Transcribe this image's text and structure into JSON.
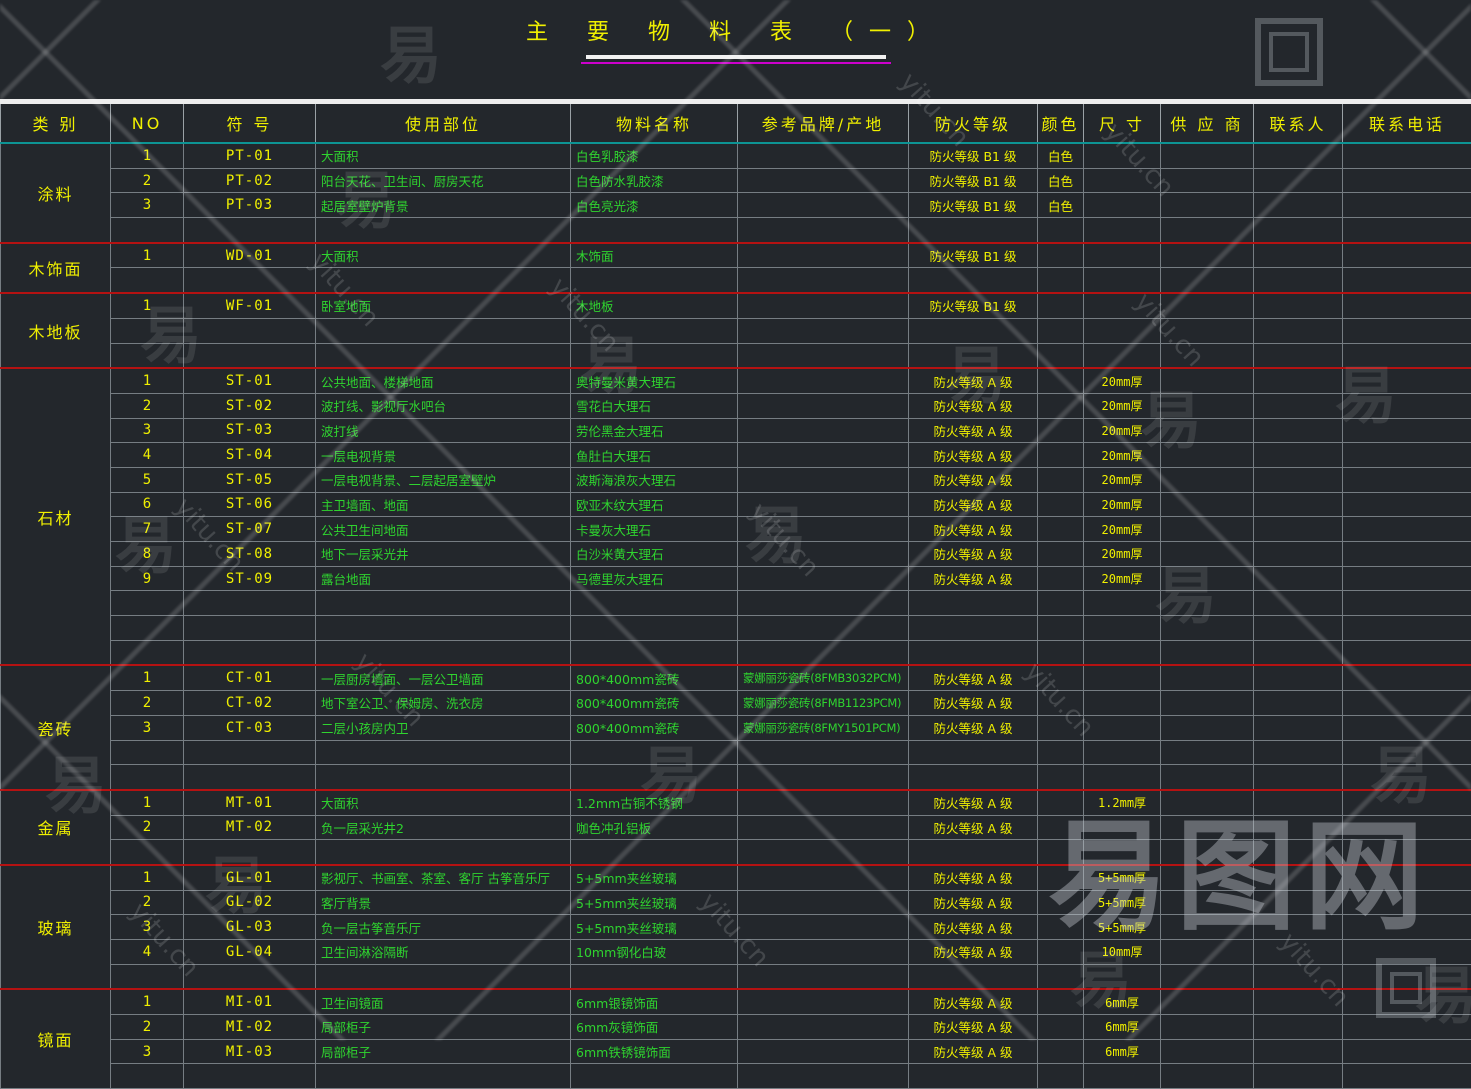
{
  "title": {
    "text": "主 要 物 料 表 （一）"
  },
  "colors": {
    "background": "#23272c",
    "text_yellow": "#f0f000",
    "text_green": "#2fd42f",
    "section_line_red": "#b51212",
    "header_line_teal": "#0d9494",
    "title_underline_white": "#f2f2f2",
    "title_underline_magenta": "#cc00cc"
  },
  "watermark": {
    "site_text": "yitu.cn",
    "brand_text": "易图网",
    "glyph_text": "易"
  },
  "table": {
    "headers": [
      "类 别",
      "NO",
      "符   号",
      "使用部位",
      "物料名称",
      "参考品牌/产地",
      "防火等级",
      "颜色",
      "尺  寸",
      "供  应  商",
      "联系人",
      "联系电话"
    ],
    "column_keys": [
      "no",
      "code",
      "location",
      "material",
      "brand",
      "fire",
      "color",
      "size",
      "supplier",
      "contact",
      "phone"
    ],
    "sections": [
      {
        "category": "涂料",
        "trailing_empty_rows": 1,
        "rows": [
          {
            "no": "1",
            "code": "PT-01",
            "location": "大面积",
            "material": "白色乳胶漆",
            "brand": "",
            "fire": "防火等级 B1 级",
            "color": "白色",
            "size": "",
            "supplier": "",
            "contact": "",
            "phone": ""
          },
          {
            "no": "2",
            "code": "PT-02",
            "location": "阳台天花、卫生间、厨房天花",
            "material": "白色防水乳胶漆",
            "brand": "",
            "fire": "防火等级 B1 级",
            "color": "白色",
            "size": "",
            "supplier": "",
            "contact": "",
            "phone": ""
          },
          {
            "no": "3",
            "code": "PT-03",
            "location": "起居室壁炉背景",
            "material": "白色亮光漆",
            "brand": "",
            "fire": "防火等级 B1 级",
            "color": "白色",
            "size": "",
            "supplier": "",
            "contact": "",
            "phone": ""
          }
        ]
      },
      {
        "category": "木饰面",
        "trailing_empty_rows": 1,
        "rows": [
          {
            "no": "1",
            "code": "WD-01",
            "location": "大面积",
            "material": "木饰面",
            "brand": "",
            "fire": "防火等级 B1 级",
            "color": "",
            "size": "",
            "supplier": "",
            "contact": "",
            "phone": ""
          }
        ]
      },
      {
        "category": "木地板",
        "trailing_empty_rows": 2,
        "rows": [
          {
            "no": "1",
            "code": "WF-01",
            "location": "卧室地面",
            "material": "木地板",
            "brand": "",
            "fire": "防火等级 B1 级",
            "color": "",
            "size": "",
            "supplier": "",
            "contact": "",
            "phone": ""
          }
        ]
      },
      {
        "category": "石材",
        "trailing_empty_rows": 3,
        "rows": [
          {
            "no": "1",
            "code": "ST-01",
            "location": "公共地面、楼梯地面",
            "material": "奥特曼米黄大理石",
            "brand": "",
            "fire": "防火等级 A 级",
            "color": "",
            "size": "20mm厚",
            "supplier": "",
            "contact": "",
            "phone": ""
          },
          {
            "no": "2",
            "code": "ST-02",
            "location": "波打线、影视厅水吧台",
            "material": "雪花白大理石",
            "brand": "",
            "fire": "防火等级 A 级",
            "color": "",
            "size": "20mm厚",
            "supplier": "",
            "contact": "",
            "phone": ""
          },
          {
            "no": "3",
            "code": "ST-03",
            "location": "波打线",
            "material": "劳伦黑金大理石",
            "brand": "",
            "fire": "防火等级 A 级",
            "color": "",
            "size": "20mm厚",
            "supplier": "",
            "contact": "",
            "phone": ""
          },
          {
            "no": "4",
            "code": "ST-04",
            "location": "一层电视背景",
            "material": "鱼肚白大理石",
            "brand": "",
            "fire": "防火等级 A 级",
            "color": "",
            "size": "20mm厚",
            "supplier": "",
            "contact": "",
            "phone": ""
          },
          {
            "no": "5",
            "code": "ST-05",
            "location": "一层电视背景、二层起居室壁炉",
            "material": "波斯海浪灰大理石",
            "brand": "",
            "fire": "防火等级 A 级",
            "color": "",
            "size": "20mm厚",
            "supplier": "",
            "contact": "",
            "phone": ""
          },
          {
            "no": "6",
            "code": "ST-06",
            "location": "主卫墙面、地面",
            "material": "欧亚木纹大理石",
            "brand": "",
            "fire": "防火等级 A 级",
            "color": "",
            "size": "20mm厚",
            "supplier": "",
            "contact": "",
            "phone": ""
          },
          {
            "no": "7",
            "code": "ST-07",
            "location": "公共卫生间地面",
            "material": "卡曼灰大理石",
            "brand": "",
            "fire": "防火等级 A 级",
            "color": "",
            "size": "20mm厚",
            "supplier": "",
            "contact": "",
            "phone": ""
          },
          {
            "no": "8",
            "code": "ST-08",
            "location": "地下一层采光井",
            "material": "白沙米黄大理石",
            "brand": "",
            "fire": "防火等级 A 级",
            "color": "",
            "size": "20mm厚",
            "supplier": "",
            "contact": "",
            "phone": ""
          },
          {
            "no": "9",
            "code": "ST-09",
            "location": "露台地面",
            "material": "马德里灰大理石",
            "brand": "",
            "fire": "防火等级 A 级",
            "color": "",
            "size": "20mm厚",
            "supplier": "",
            "contact": "",
            "phone": ""
          }
        ]
      },
      {
        "category": "瓷砖",
        "trailing_empty_rows": 2,
        "rows": [
          {
            "no": "1",
            "code": "CT-01",
            "location": "一层厨房墙面、一层公卫墙面",
            "material": "800*400mm瓷砖",
            "brand": "蒙娜丽莎瓷砖(8FMB3032PCM)",
            "fire": "防火等级 A 级",
            "color": "",
            "size": "",
            "supplier": "",
            "contact": "",
            "phone": ""
          },
          {
            "no": "2",
            "code": "CT-02",
            "location": "地下室公卫、保姆房、洗衣房",
            "material": "800*400mm瓷砖",
            "brand": "蒙娜丽莎瓷砖(8FMB1123PCM)",
            "fire": "防火等级 A 级",
            "color": "",
            "size": "",
            "supplier": "",
            "contact": "",
            "phone": ""
          },
          {
            "no": "3",
            "code": "CT-03",
            "location": "二层小孩房内卫",
            "material": "800*400mm瓷砖",
            "brand": "蒙娜丽莎瓷砖(8FMY1501PCM)",
            "fire": "防火等级 A 级",
            "color": "",
            "size": "",
            "supplier": "",
            "contact": "",
            "phone": ""
          }
        ]
      },
      {
        "category": "金属",
        "trailing_empty_rows": 1,
        "rows": [
          {
            "no": "1",
            "code": "MT-01",
            "location": "大面积",
            "material": "1.2mm古铜不锈钢",
            "brand": "",
            "fire": "防火等级 A 级",
            "color": "",
            "size": "1.2mm厚",
            "supplier": "",
            "contact": "",
            "phone": ""
          },
          {
            "no": "2",
            "code": "MT-02",
            "location": "负一层采光井2",
            "material": "咖色冲孔铝板",
            "brand": "",
            "fire": "防火等级 A 级",
            "color": "",
            "size": "",
            "supplier": "",
            "contact": "",
            "phone": ""
          }
        ]
      },
      {
        "category": "玻璃",
        "trailing_empty_rows": 1,
        "rows": [
          {
            "no": "1",
            "code": "GL-01",
            "location": "影视厅、书画室、茶室、客厅 古筝音乐厅",
            "material": "5+5mm夹丝玻璃",
            "brand": "",
            "fire": "防火等级 A 级",
            "color": "",
            "size": "5+5mm厚",
            "supplier": "",
            "contact": "",
            "phone": ""
          },
          {
            "no": "2",
            "code": "GL-02",
            "location": "客厅背景",
            "material": "5+5mm夹丝玻璃",
            "brand": "",
            "fire": "防火等级 A 级",
            "color": "",
            "size": "5+5mm厚",
            "supplier": "",
            "contact": "",
            "phone": ""
          },
          {
            "no": "3",
            "code": "GL-03",
            "location": "负一层古筝音乐厅",
            "material": "5+5mm夹丝玻璃",
            "brand": "",
            "fire": "防火等级 A 级",
            "color": "",
            "size": "5+5mm厚",
            "supplier": "",
            "contact": "",
            "phone": ""
          },
          {
            "no": "4",
            "code": "GL-04",
            "location": "卫生间淋浴隔断",
            "material": "10mm钢化白玻",
            "brand": "",
            "fire": "防火等级 A 级",
            "color": "",
            "size": "10mm厚",
            "supplier": "",
            "contact": "",
            "phone": ""
          }
        ]
      },
      {
        "category": "镜面",
        "trailing_empty_rows": 1,
        "rows": [
          {
            "no": "1",
            "code": "MI-01",
            "location": "卫生间镜面",
            "material": "6mm银镜饰面",
            "brand": "",
            "fire": "防火等级 A 级",
            "color": "",
            "size": "6mm厚",
            "supplier": "",
            "contact": "",
            "phone": ""
          },
          {
            "no": "2",
            "code": "MI-02",
            "location": "局部柜子",
            "material": "6mm灰镜饰面",
            "brand": "",
            "fire": "防火等级 A 级",
            "color": "",
            "size": "6mm厚",
            "supplier": "",
            "contact": "",
            "phone": ""
          },
          {
            "no": "3",
            "code": "MI-03",
            "location": "局部柜子",
            "material": "6mm铁锈镜饰面",
            "brand": "",
            "fire": "防火等级 A 级",
            "color": "",
            "size": "6mm厚",
            "supplier": "",
            "contact": "",
            "phone": ""
          }
        ]
      }
    ]
  }
}
